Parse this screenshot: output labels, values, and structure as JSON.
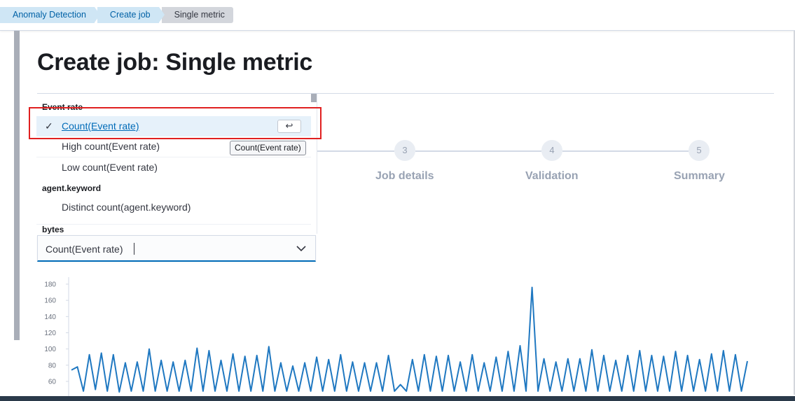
{
  "breadcrumbs": [
    "Anomaly Detection",
    "Create job",
    "Single metric"
  ],
  "page_title": "Create job: Single metric",
  "steps": [
    {
      "number": "3",
      "label": "Job details"
    },
    {
      "number": "4",
      "label": "Validation"
    },
    {
      "number": "5",
      "label": "Summary"
    }
  ],
  "dropdown": {
    "groups": [
      {
        "title": "Event rate",
        "options": [
          "Count(Event rate)",
          "High count(Event rate)",
          "Low count(Event rate)"
        ]
      },
      {
        "title": "agent.keyword",
        "options": [
          "Distinct count(agent.keyword)"
        ]
      },
      {
        "title": "bytes",
        "options": []
      }
    ],
    "selected_check": "✓",
    "enter_key": "↩"
  },
  "tooltip": "Count(Event rate)",
  "combo": {
    "value": "Count(Event rate)"
  },
  "chart_data": {
    "type": "line",
    "y_ticks": [
      "180",
      "160",
      "140",
      "120",
      "100",
      "80",
      "60"
    ],
    "ylim": [
      40,
      190
    ],
    "values": [
      74,
      78,
      48,
      93,
      50,
      95,
      48,
      93,
      47,
      83,
      48,
      84,
      48,
      100,
      48,
      86,
      48,
      84,
      48,
      86,
      48,
      101,
      48,
      98,
      48,
      86,
      48,
      94,
      48,
      91,
      48,
      92,
      48,
      103,
      48,
      83,
      48,
      79,
      48,
      83,
      48,
      90,
      48,
      87,
      48,
      93,
      48,
      84,
      48,
      83,
      48,
      83,
      48,
      92,
      48,
      56,
      48,
      87,
      48,
      93,
      48,
      91,
      48,
      92,
      48,
      84,
      48,
      93,
      48,
      83,
      48,
      90,
      48,
      97,
      48,
      104,
      48,
      176,
      48,
      88,
      48,
      84,
      48,
      88,
      48,
      88,
      48,
      99,
      48,
      92,
      48,
      86,
      48,
      92,
      48,
      98,
      48,
      92,
      48,
      91,
      48,
      97,
      48,
      92,
      48,
      87,
      48,
      94,
      48,
      98,
      48,
      93,
      48,
      85
    ],
    "color": "#1f78c1"
  }
}
